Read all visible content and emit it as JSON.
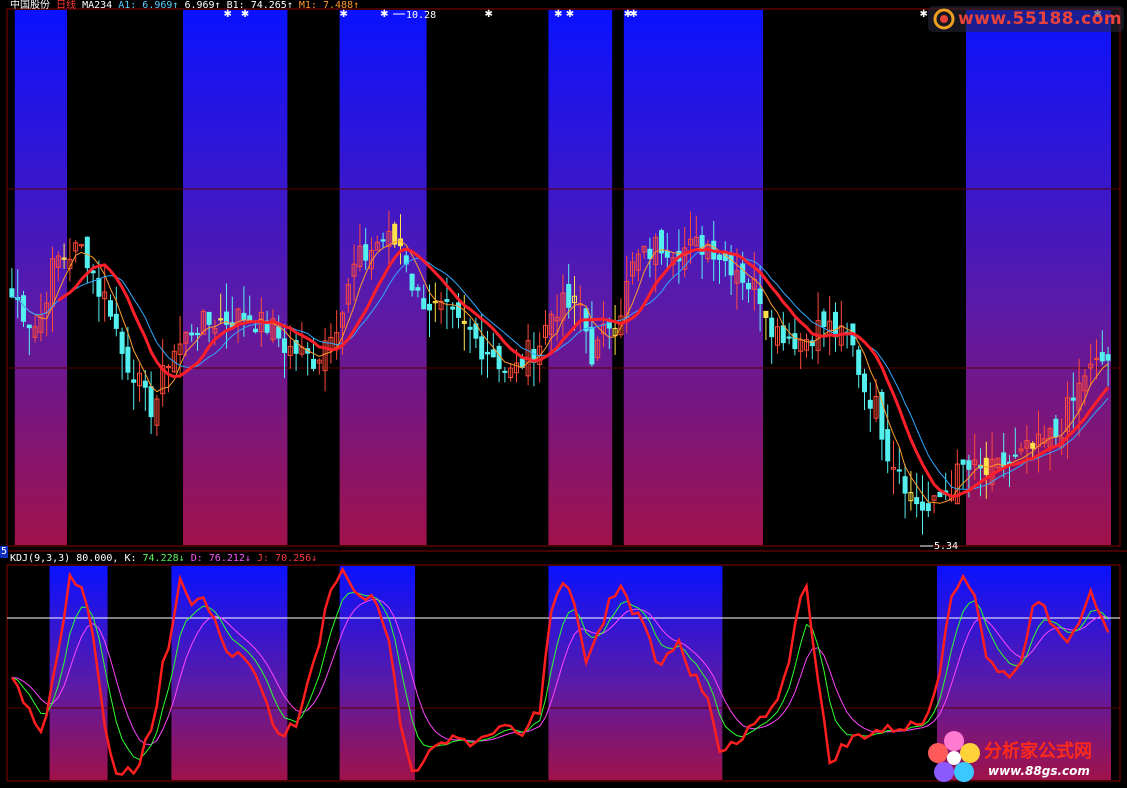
{
  "header": {
    "stock_name": "中国股份",
    "period": "日线",
    "indicator": "MA234",
    "a1_label": "A1:",
    "a1_value": "6.969↑",
    "a1_value2": "6.969↑",
    "b1_label": "B1:",
    "b1_value": "74.265↑",
    "m1_label": "M1:",
    "m1_value": "7.488↑"
  },
  "annotations": {
    "price_high": "10.28",
    "price_low": "5.34",
    "lower_panel_index": "5"
  },
  "kdj_header": {
    "name": "KDJ(9,3,3)",
    "level": "80.000,",
    "k_label": "K:",
    "k_value": "74.228↓",
    "d_label": "D:",
    "d_value": "76.212↓",
    "j_label": "J:",
    "j_value": "70.256↓"
  },
  "watermarks": {
    "top_url": "www.55188.com",
    "bottom_name": "分析家公式网",
    "bottom_url": "www.88gs.com"
  },
  "colors": {
    "background": "#000000",
    "candle_up": "#ff4a3a",
    "candle_down": "#54f0f0",
    "candle_special": "#ffe24a",
    "ma_main": "#ff1f2a",
    "ma_fast": "#ff9a2a",
    "ma_slow": "#2fa8ff",
    "band_top": "#0a12ff",
    "band_bottom": "#a0124a",
    "kdj_k": "#ffffff",
    "kdj_d": "#ff44ff",
    "kdj_j": "#ff1f1f",
    "kdj_green": "#2cff2c",
    "grid": "#7a0000"
  },
  "chart_data": {
    "type": "candlestick",
    "price_high_marked": 10.28,
    "price_low_marked": 5.34,
    "ylim": [
      5.0,
      10.6
    ],
    "kdj_ylim": [
      -10,
      110
    ],
    "kdj_level": 80,
    "last_values": {
      "A1": 6.969,
      "B1": 74.265,
      "M1": 7.488,
      "K": 74.228,
      "D": 76.212,
      "J": 70.256
    },
    "highlight_band_bars": [
      [
        1,
        10
      ],
      [
        30,
        48
      ],
      [
        57,
        72
      ],
      [
        93,
        104
      ],
      [
        106,
        130
      ],
      [
        165,
        190
      ]
    ],
    "kdj_band_bars": [
      [
        7,
        17
      ],
      [
        28,
        48
      ],
      [
        57,
        70
      ],
      [
        93,
        123
      ],
      [
        160,
        190
      ]
    ],
    "price_anchors": [
      [
        0,
        7.6
      ],
      [
        4,
        7.3
      ],
      [
        8,
        8.0
      ],
      [
        12,
        8.1
      ],
      [
        16,
        7.6
      ],
      [
        20,
        6.9
      ],
      [
        24,
        6.45
      ],
      [
        28,
        7.05
      ],
      [
        32,
        7.3
      ],
      [
        36,
        7.35
      ],
      [
        40,
        7.4
      ],
      [
        44,
        7.3
      ],
      [
        48,
        7.05
      ],
      [
        52,
        6.95
      ],
      [
        56,
        7.35
      ],
      [
        60,
        8.0
      ],
      [
        64,
        8.2
      ],
      [
        67,
        8.15
      ],
      [
        70,
        7.6
      ],
      [
        74,
        7.45
      ],
      [
        78,
        7.25
      ],
      [
        82,
        7.05
      ],
      [
        86,
        6.8
      ],
      [
        90,
        7.05
      ],
      [
        94,
        7.5
      ],
      [
        98,
        7.5
      ],
      [
        100,
        7.0
      ],
      [
        104,
        7.4
      ],
      [
        108,
        8.0
      ],
      [
        112,
        8.15
      ],
      [
        116,
        8.1
      ],
      [
        120,
        8.15
      ],
      [
        124,
        7.95
      ],
      [
        128,
        7.7
      ],
      [
        132,
        7.25
      ],
      [
        136,
        7.15
      ],
      [
        140,
        7.3
      ],
      [
        144,
        7.15
      ],
      [
        148,
        6.55
      ],
      [
        152,
        5.9
      ],
      [
        156,
        5.45
      ],
      [
        158,
        5.35
      ],
      [
        161,
        5.55
      ],
      [
        164,
        5.8
      ],
      [
        168,
        5.75
      ],
      [
        172,
        5.85
      ],
      [
        176,
        6.0
      ],
      [
        180,
        6.15
      ],
      [
        183,
        6.5
      ],
      [
        185,
        6.8
      ],
      [
        189,
        6.95
      ]
    ],
    "kdj_j_anchors": [
      [
        0,
        45
      ],
      [
        3,
        30
      ],
      [
        5,
        15
      ],
      [
        8,
        60
      ],
      [
        10,
        105
      ],
      [
        12,
        100
      ],
      [
        14,
        70
      ],
      [
        16,
        20
      ],
      [
        18,
        -5
      ],
      [
        21,
        -5
      ],
      [
        24,
        20
      ],
      [
        27,
        65
      ],
      [
        29,
        105
      ],
      [
        31,
        90
      ],
      [
        33,
        95
      ],
      [
        35,
        78
      ],
      [
        37,
        62
      ],
      [
        40,
        58
      ],
      [
        42,
        48
      ],
      [
        44,
        30
      ],
      [
        46,
        15
      ],
      [
        49,
        20
      ],
      [
        52,
        55
      ],
      [
        55,
        95
      ],
      [
        57,
        108
      ],
      [
        60,
        95
      ],
      [
        63,
        90
      ],
      [
        65,
        70
      ],
      [
        67,
        20
      ],
      [
        69,
        -5
      ],
      [
        72,
        5
      ],
      [
        76,
        15
      ],
      [
        80,
        10
      ],
      [
        84,
        20
      ],
      [
        88,
        15
      ],
      [
        91,
        30
      ],
      [
        93,
        85
      ],
      [
        95,
        100
      ],
      [
        97,
        90
      ],
      [
        99,
        55
      ],
      [
        101,
        70
      ],
      [
        103,
        90
      ],
      [
        105,
        98
      ],
      [
        107,
        85
      ],
      [
        109,
        80
      ],
      [
        111,
        55
      ],
      [
        113,
        60
      ],
      [
        115,
        70
      ],
      [
        117,
        50
      ],
      [
        120,
        35
      ],
      [
        122,
        5
      ],
      [
        125,
        10
      ],
      [
        128,
        20
      ],
      [
        131,
        30
      ],
      [
        134,
        55
      ],
      [
        136,
        95
      ],
      [
        137,
        100
      ],
      [
        139,
        45
      ],
      [
        141,
        0
      ],
      [
        143,
        8
      ],
      [
        146,
        15
      ],
      [
        150,
        18
      ],
      [
        154,
        20
      ],
      [
        157,
        22
      ],
      [
        159,
        40
      ],
      [
        162,
        90
      ],
      [
        164,
        105
      ],
      [
        166,
        95
      ],
      [
        168,
        60
      ],
      [
        170,
        50
      ],
      [
        172,
        50
      ],
      [
        174,
        55
      ],
      [
        176,
        90
      ],
      [
        178,
        85
      ],
      [
        180,
        75
      ],
      [
        182,
        70
      ],
      [
        184,
        80
      ],
      [
        186,
        98
      ],
      [
        188,
        78
      ],
      [
        189,
        70
      ]
    ]
  }
}
